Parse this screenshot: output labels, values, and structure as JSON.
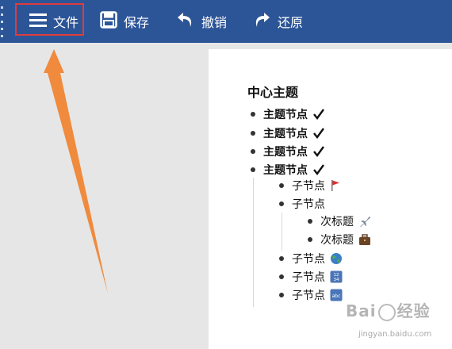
{
  "toolbar": {
    "file_label": "文件",
    "save_label": "保存",
    "undo_label": "撤销",
    "redo_label": "还原",
    "background_color": "#2c5598",
    "highlight_color": "#e13b3b"
  },
  "annotation": {
    "arrow_color": "#f08a3c"
  },
  "mindmap": {
    "title": "中心主题",
    "topics": [
      {
        "label": "主题节点",
        "icon": "check-icon"
      },
      {
        "label": "主题节点",
        "icon": "check-icon"
      },
      {
        "label": "主题节点",
        "icon": "check-icon"
      },
      {
        "label": "主题节点",
        "icon": "check-icon"
      }
    ],
    "children": [
      {
        "label": "子节点",
        "icon": "red-flag-icon"
      },
      {
        "label": "子节点",
        "icon": ""
      },
      {
        "label": "子节点",
        "icon": "globe-icon"
      },
      {
        "label": "子节点",
        "icon": "numbers-1234-icon"
      },
      {
        "label": "子节点",
        "icon": "abc-icon"
      }
    ],
    "grandchildren": [
      {
        "label": "次标题",
        "icon": "airplane-icon"
      },
      {
        "label": "次标题",
        "icon": "briefcase-icon"
      }
    ]
  },
  "watermark": {
    "brand": "Bai",
    "brand_suffix": "经验",
    "url": "jingyan.baidu.com"
  }
}
